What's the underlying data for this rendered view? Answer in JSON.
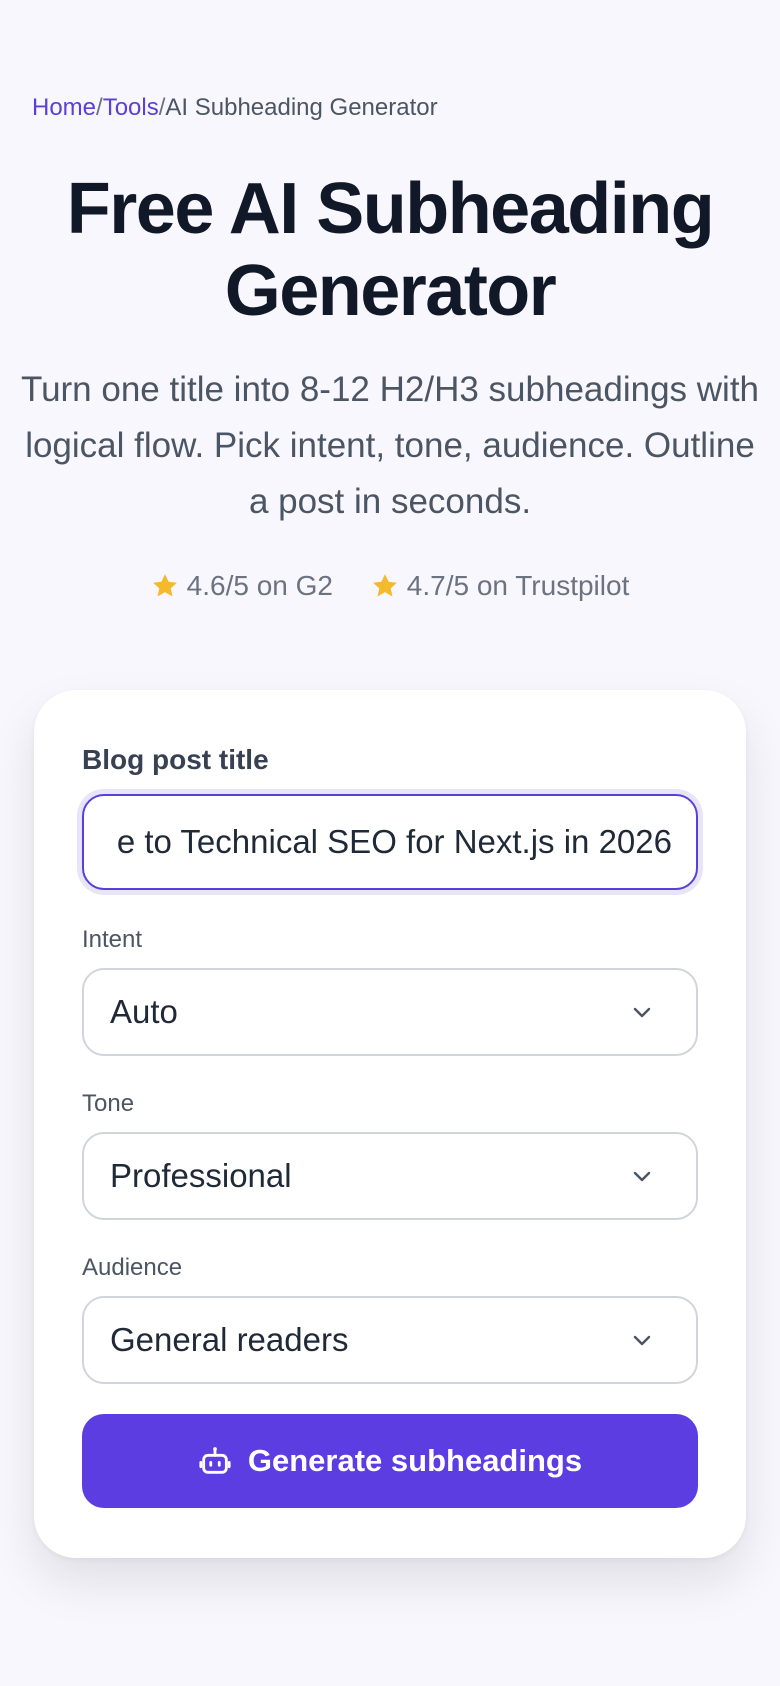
{
  "breadcrumb": {
    "home": "Home",
    "separator": "/",
    "tools": "Tools",
    "current": "AI Subheading Generator"
  },
  "hero": {
    "title_line1": "Free AI Subheading",
    "title_line2": "Generator",
    "subtitle": "Turn one title into 8-12 H2/H3 subheadings with logical flow. Pick intent, tone, audience. Outline a post in seconds."
  },
  "ratings": [
    {
      "icon": "star-icon",
      "text": "4.6/5 on G2"
    },
    {
      "icon": "star-icon",
      "text": "4.7/5 on Trustpilot"
    }
  ],
  "form": {
    "title_label": "Blog post title",
    "title_value": "e to Technical SEO for Next.js in 2026",
    "intent_label": "Intent",
    "intent_value": "Auto",
    "tone_label": "Tone",
    "tone_value": "Professional",
    "audience_label": "Audience",
    "audience_value": "General readers",
    "generate_label": "Generate subheadings",
    "generate_icon": "robot-icon"
  },
  "colors": {
    "accent": "#5b3de2",
    "link": "#5b3fd9",
    "star": "#f5b92c",
    "background": "#f8f7fd"
  }
}
